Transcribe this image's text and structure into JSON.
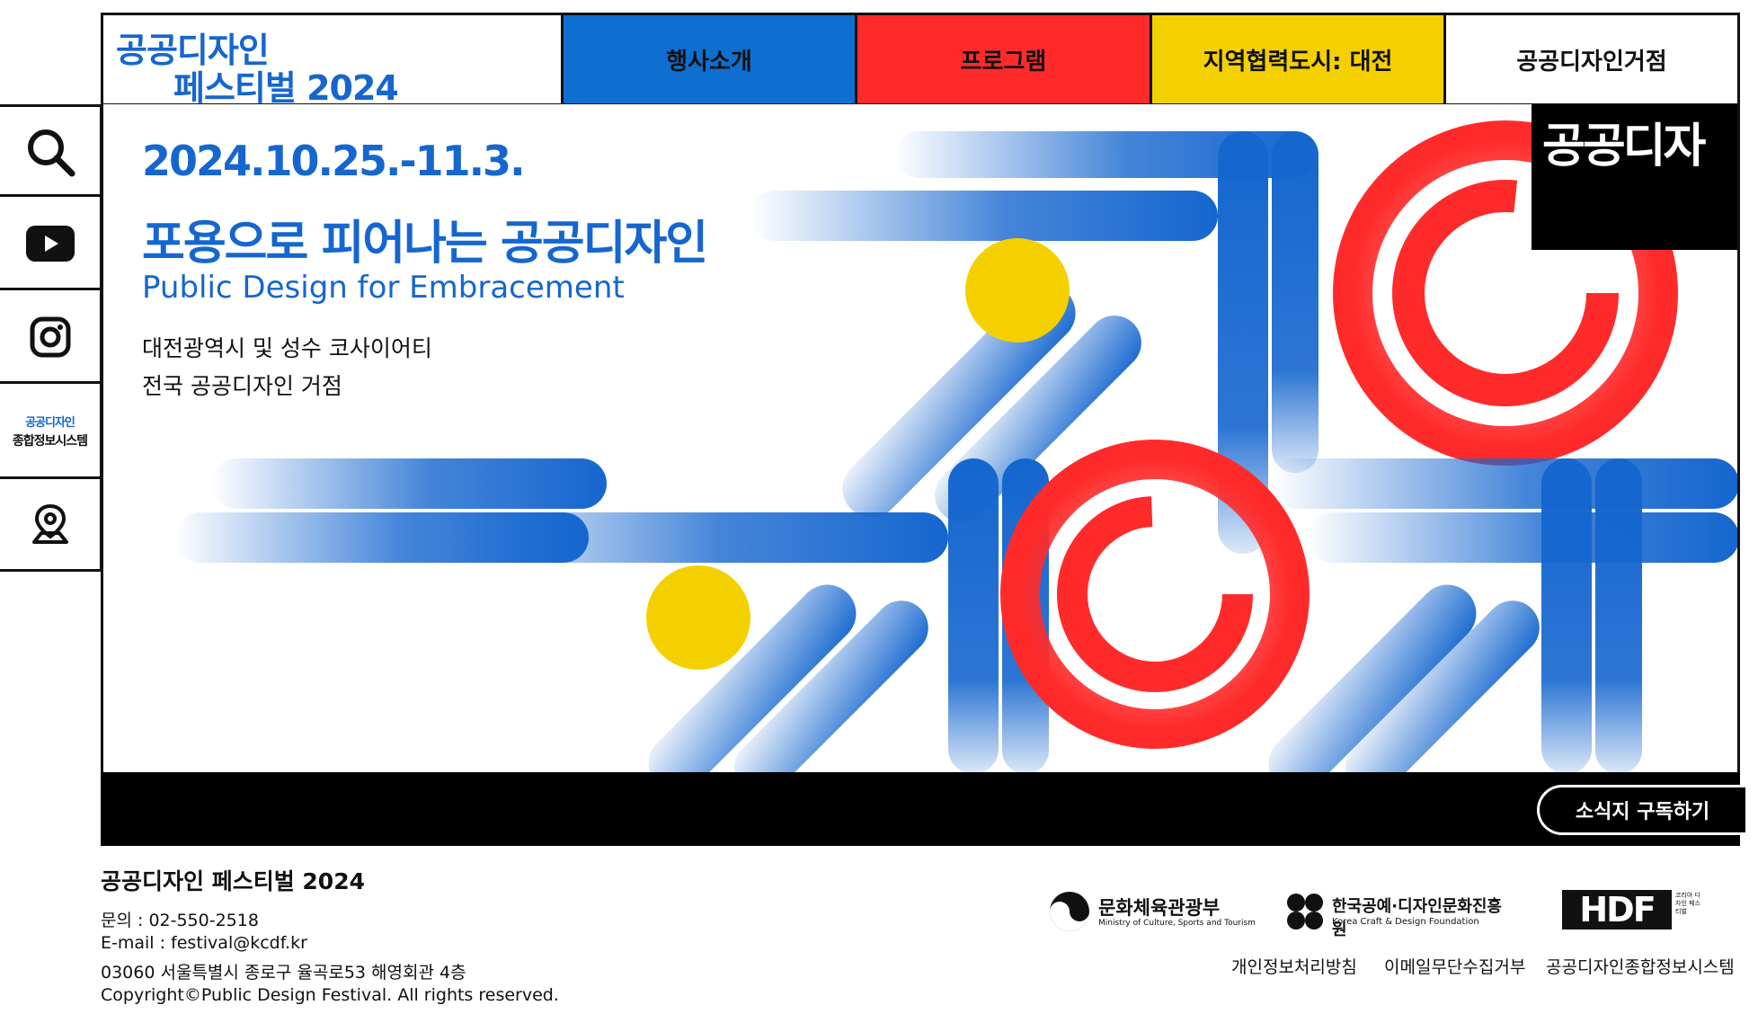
{
  "logo": {
    "line1": "공공디자인",
    "line2": "페스티벌 2024"
  },
  "nav": [
    "행사소개",
    "프로그램",
    "지역협력도시: 대전",
    "공공디자인거점"
  ],
  "rail": {
    "search_icon": "search-icon",
    "youtube_icon": "youtube-icon",
    "instagram_icon": "instagram-icon",
    "info_top": "공공디자인",
    "info_bottom": "종합정보시스템",
    "map_icon": "map-pin-icon"
  },
  "hero": {
    "date": "2024.10.25.-11.3.",
    "title": "포용으로 피어나는 공공디자인",
    "subtitle": "Public Design for Embracement",
    "location_line1": "대전광역시 및 성수 코사이어티",
    "location_line2": "전국 공공디자인 거점",
    "badge": "공공디자인"
  },
  "subscribe": "소식지 구독하기",
  "footer": {
    "title": "공공디자인 페스티벌 2024",
    "phone": "문의 : 02-550-2518",
    "email": "E-mail : festival@kcdf.kr",
    "address": "03060 서울특별시 종로구 율곡로53 해영회관 4층",
    "copyright": "Copyright©Public Design Festival. All rights reserved.",
    "orgs": [
      {
        "name": "문화체육관광부",
        "en": "Ministry of Culture, Sports and Tourism"
      },
      {
        "name": "한국공예·디자인문화진흥원",
        "en": "Korea Craft & Design Foundation"
      },
      {
        "name": "HDF",
        "small": "코리아 디자인 페스티벌"
      }
    ],
    "links": [
      "개인정보처리방침",
      "이메일무단수집거부",
      "공공디자인종합정보시스템"
    ]
  },
  "colors": {
    "blue": "#1566cf",
    "red": "#ff2b2b",
    "yellow": "#f5d000",
    "black": "#000000"
  }
}
